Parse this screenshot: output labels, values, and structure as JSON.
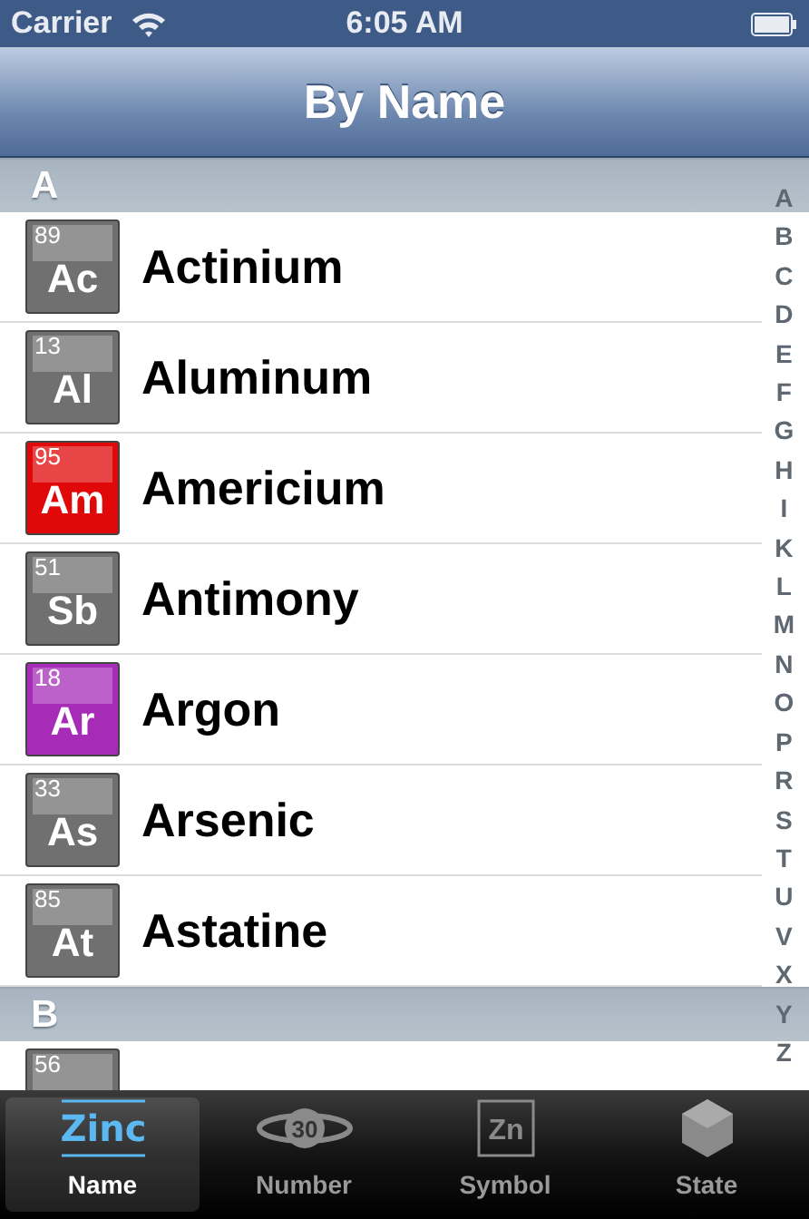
{
  "status_bar": {
    "carrier": "Carrier",
    "time": "6:05 AM"
  },
  "nav_bar": {
    "title": "By Name"
  },
  "sections": [
    {
      "header": "A",
      "rows": [
        {
          "number": "89",
          "symbol": "Ac",
          "name": "Actinium",
          "color": "#707070"
        },
        {
          "number": "13",
          "symbol": "Al",
          "name": "Aluminum",
          "color": "#707070"
        },
        {
          "number": "95",
          "symbol": "Am",
          "name": "Americium",
          "color": "#e00808"
        },
        {
          "number": "51",
          "symbol": "Sb",
          "name": "Antimony",
          "color": "#707070"
        },
        {
          "number": "18",
          "symbol": "Ar",
          "name": "Argon",
          "color": "#a62cb8"
        },
        {
          "number": "33",
          "symbol": "As",
          "name": "Arsenic",
          "color": "#707070"
        },
        {
          "number": "85",
          "symbol": "At",
          "name": "Astatine",
          "color": "#707070"
        }
      ]
    },
    {
      "header": "B",
      "rows": [
        {
          "number": "56",
          "color": "#707070"
        }
      ]
    }
  ],
  "index": [
    "A",
    "B",
    "C",
    "D",
    "E",
    "F",
    "G",
    "H",
    "I",
    "K",
    "L",
    "M",
    "N",
    "O",
    "P",
    "R",
    "S",
    "T",
    "U",
    "V",
    "X",
    "Y",
    "Z"
  ],
  "tabs": [
    {
      "label": "Name",
      "icon_text": "Zinc",
      "kind": "name",
      "selected": true
    },
    {
      "label": "Number",
      "icon_text": "30",
      "kind": "number",
      "selected": false
    },
    {
      "label": "Symbol",
      "icon_text": "Zn",
      "kind": "symbol",
      "selected": false
    },
    {
      "label": "State",
      "kind": "state",
      "selected": false
    }
  ]
}
